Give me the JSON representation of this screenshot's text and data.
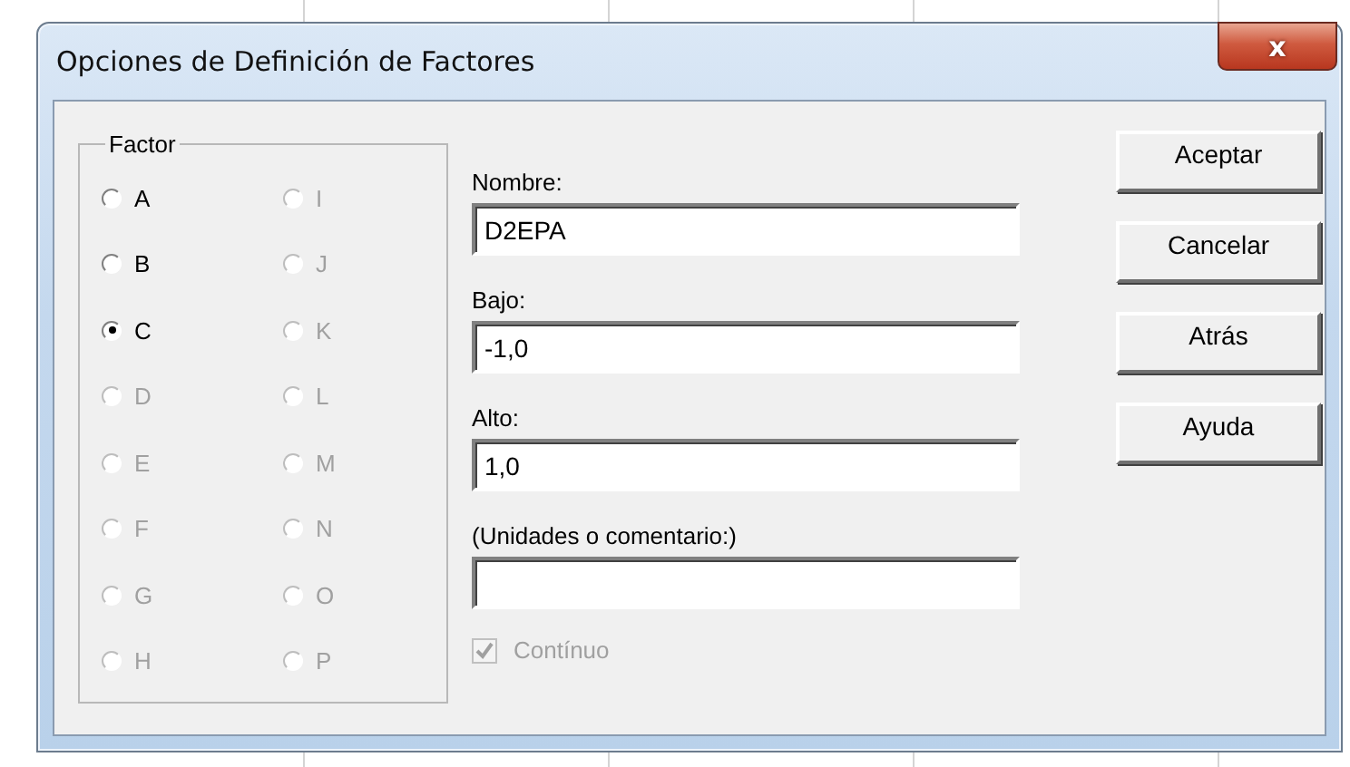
{
  "window": {
    "title": "Opciones de Definición de Factores",
    "close": "x"
  },
  "factor_group": {
    "title": "Factor",
    "options": [
      {
        "label": "A",
        "selected": false,
        "disabled": false
      },
      {
        "label": "B",
        "selected": false,
        "disabled": false
      },
      {
        "label": "C",
        "selected": true,
        "disabled": false
      },
      {
        "label": "D",
        "selected": false,
        "disabled": true
      },
      {
        "label": "E",
        "selected": false,
        "disabled": true
      },
      {
        "label": "F",
        "selected": false,
        "disabled": true
      },
      {
        "label": "G",
        "selected": false,
        "disabled": true
      },
      {
        "label": "H",
        "selected": false,
        "disabled": true
      },
      {
        "label": "I",
        "selected": false,
        "disabled": true
      },
      {
        "label": "J",
        "selected": false,
        "disabled": true
      },
      {
        "label": "K",
        "selected": false,
        "disabled": true
      },
      {
        "label": "L",
        "selected": false,
        "disabled": true
      },
      {
        "label": "M",
        "selected": false,
        "disabled": true
      },
      {
        "label": "N",
        "selected": false,
        "disabled": true
      },
      {
        "label": "O",
        "selected": false,
        "disabled": true
      },
      {
        "label": "P",
        "selected": false,
        "disabled": true
      }
    ]
  },
  "fields": [
    {
      "label": "Nombre:",
      "value": "D2EPA"
    },
    {
      "label": "Bajo:",
      "value": "-1,0"
    },
    {
      "label": "Alto:",
      "value": "1,0"
    },
    {
      "label": "(Unidades o comentario:)"
    }
  ],
  "continuous": {
    "label": "Contínuo",
    "checked": true,
    "disabled": true
  },
  "buttons": [
    "Aceptar",
    "Cancelar",
    "Atrás",
    "Ayuda"
  ]
}
